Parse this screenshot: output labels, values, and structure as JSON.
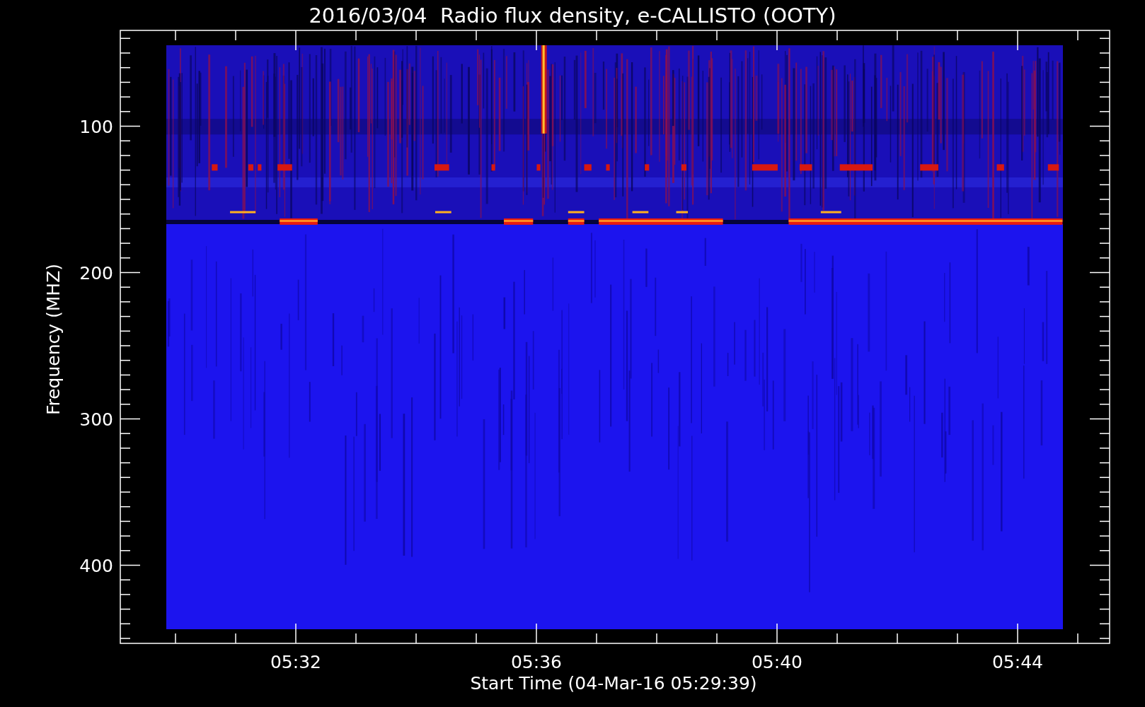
{
  "title": "2016/03/04  Radio flux density, e-CALLISTO (OOTY)",
  "plot": {
    "ylabel": "Frequency (MHZ)",
    "yticks": [
      "100",
      "200",
      "300",
      "400"
    ],
    "xticks": [
      "05:32",
      "05:36",
      "05:40",
      "05:44"
    ],
    "xlabel": "Start Time (04-Mar-16 05:29:39)"
  }
}
